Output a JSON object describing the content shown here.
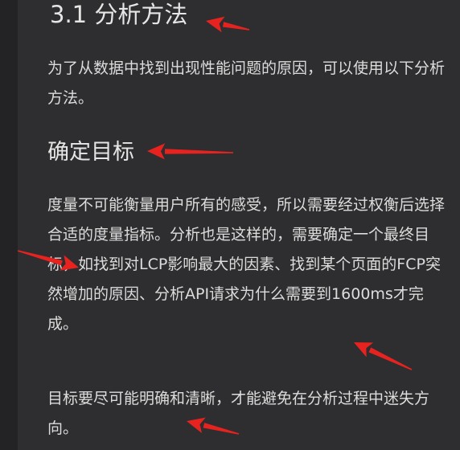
{
  "article": {
    "section_title": "3.1 分析方法",
    "intro": "为了从数据中找到出现性能问题的原因，可以使用以下分析方法。",
    "subheading": "确定目标",
    "body_paragraph": "度量不可能衡量用户所有的感受，所以需要经过权衡后选择合适的度量指标。分析也是这样的，需要确定一个最终目标，如找到对LCP影响最大的因素、找到某个页面的FCP突然增加的原因、分析API请求为什么需要到1600ms才完成。",
    "closing_paragraph": "目标要尽可能明确和清晰，才能避免在分析过程中迷失方向。"
  },
  "annotations": {
    "arrow_color": "#e8231f"
  }
}
